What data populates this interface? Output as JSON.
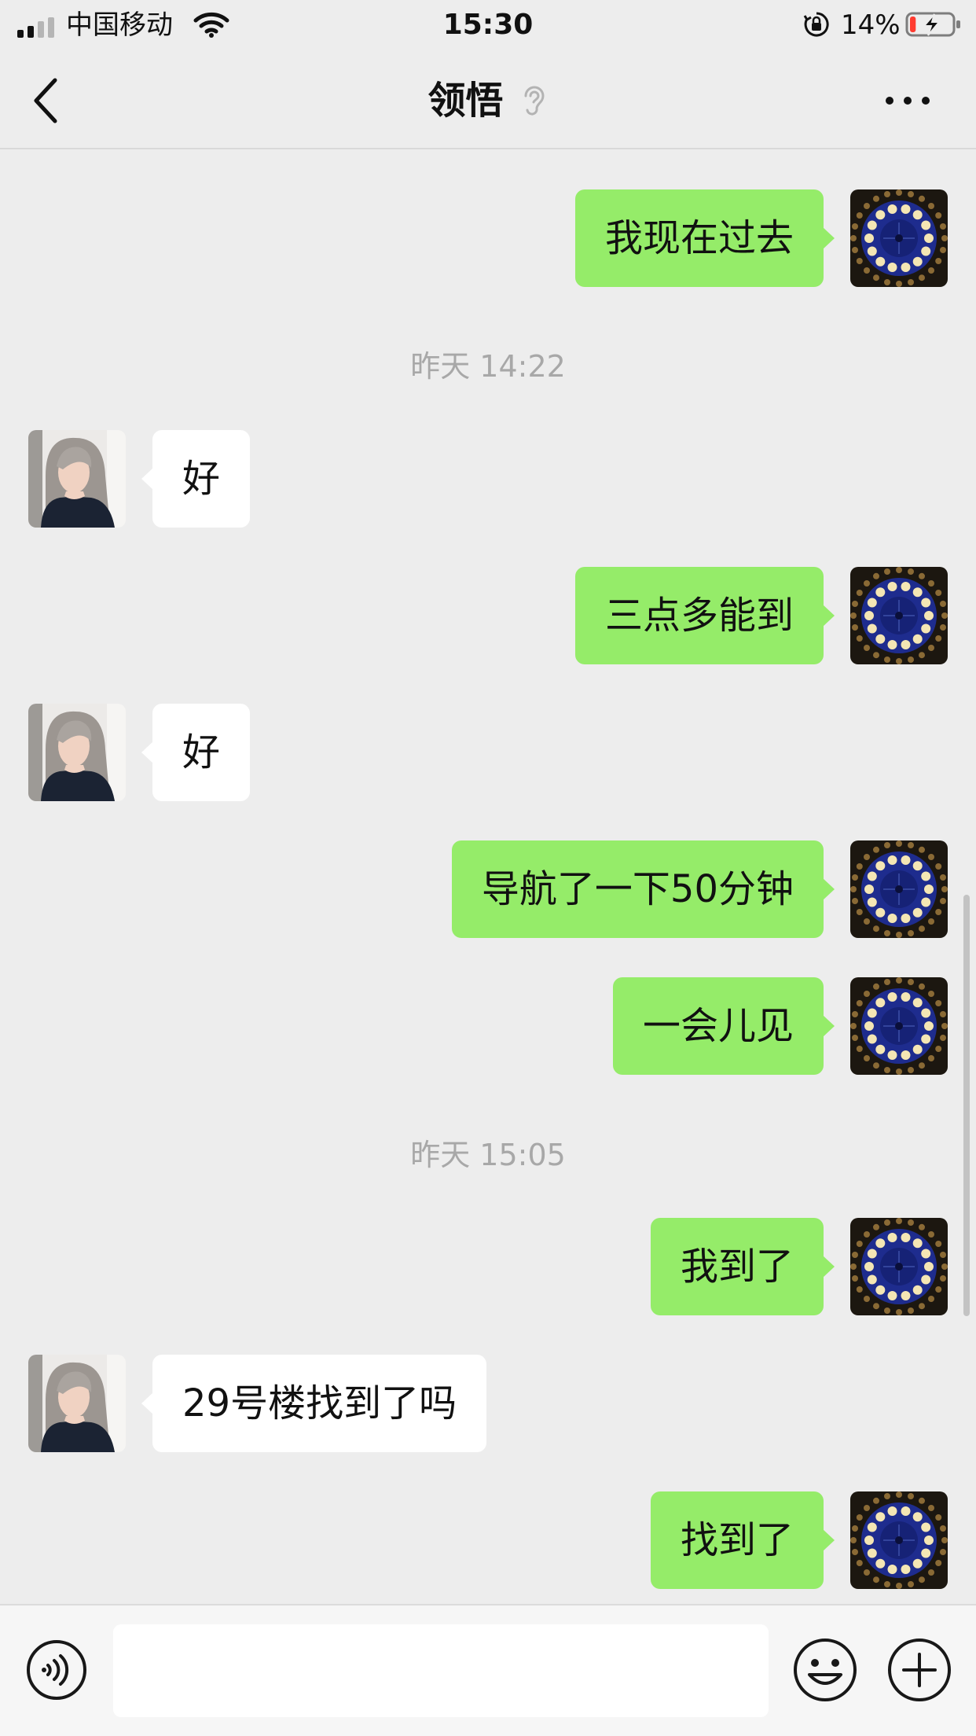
{
  "status_bar": {
    "carrier": "中国移动",
    "time": "15:30",
    "battery_percent": "14%",
    "icons": [
      "signal-icon",
      "wifi-icon",
      "orientation-lock-icon",
      "battery-charging-icon"
    ],
    "battery_level": 0.14,
    "battery_color": "#ff3b30"
  },
  "nav": {
    "title": "领悟",
    "icons": [
      "back-chevron-icon",
      "ear-icon",
      "more-dots-icon"
    ]
  },
  "chat": {
    "colors": {
      "outgoing_bubble": "#95ec69",
      "incoming_bubble": "#ffffff",
      "background": "#ededed"
    },
    "messages": [
      {
        "type": "out",
        "text": "我现在过去"
      },
      {
        "type": "time",
        "text": "昨天 14:22"
      },
      {
        "type": "in",
        "text": "好"
      },
      {
        "type": "out",
        "text": "三点多能到"
      },
      {
        "type": "in",
        "text": "好"
      },
      {
        "type": "out",
        "text": "导航了一下50分钟"
      },
      {
        "type": "out",
        "text": "一会儿见"
      },
      {
        "type": "time",
        "text": "昨天 15:05"
      },
      {
        "type": "out",
        "text": "我到了"
      },
      {
        "type": "in",
        "text": "29号楼找到了吗"
      },
      {
        "type": "out",
        "text": "找到了"
      }
    ]
  },
  "input_bar": {
    "value": "",
    "icons": [
      "voice-icon",
      "emoji-icon",
      "plus-icon"
    ]
  }
}
